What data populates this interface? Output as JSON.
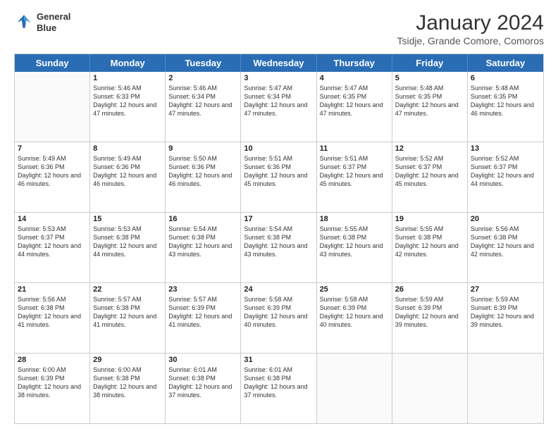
{
  "header": {
    "logo_line1": "General",
    "logo_line2": "Blue",
    "main_title": "January 2024",
    "sub_title": "Tsidje, Grande Comore, Comoros"
  },
  "days_of_week": [
    "Sunday",
    "Monday",
    "Tuesday",
    "Wednesday",
    "Thursday",
    "Friday",
    "Saturday"
  ],
  "weeks": [
    [
      {
        "day": "",
        "sunrise": "",
        "sunset": "",
        "daylight": ""
      },
      {
        "day": "1",
        "sunrise": "Sunrise: 5:46 AM",
        "sunset": "Sunset: 6:33 PM",
        "daylight": "Daylight: 12 hours and 47 minutes."
      },
      {
        "day": "2",
        "sunrise": "Sunrise: 5:46 AM",
        "sunset": "Sunset: 6:34 PM",
        "daylight": "Daylight: 12 hours and 47 minutes."
      },
      {
        "day": "3",
        "sunrise": "Sunrise: 5:47 AM",
        "sunset": "Sunset: 6:34 PM",
        "daylight": "Daylight: 12 hours and 47 minutes."
      },
      {
        "day": "4",
        "sunrise": "Sunrise: 5:47 AM",
        "sunset": "Sunset: 6:35 PM",
        "daylight": "Daylight: 12 hours and 47 minutes."
      },
      {
        "day": "5",
        "sunrise": "Sunrise: 5:48 AM",
        "sunset": "Sunset: 6:35 PM",
        "daylight": "Daylight: 12 hours and 47 minutes."
      },
      {
        "day": "6",
        "sunrise": "Sunrise: 5:48 AM",
        "sunset": "Sunset: 6:35 PM",
        "daylight": "Daylight: 12 hours and 46 minutes."
      }
    ],
    [
      {
        "day": "7",
        "sunrise": "Sunrise: 5:49 AM",
        "sunset": "Sunset: 6:36 PM",
        "daylight": "Daylight: 12 hours and 46 minutes."
      },
      {
        "day": "8",
        "sunrise": "Sunrise: 5:49 AM",
        "sunset": "Sunset: 6:36 PM",
        "daylight": "Daylight: 12 hours and 46 minutes."
      },
      {
        "day": "9",
        "sunrise": "Sunrise: 5:50 AM",
        "sunset": "Sunset: 6:36 PM",
        "daylight": "Daylight: 12 hours and 46 minutes."
      },
      {
        "day": "10",
        "sunrise": "Sunrise: 5:51 AM",
        "sunset": "Sunset: 6:36 PM",
        "daylight": "Daylight: 12 hours and 45 minutes."
      },
      {
        "day": "11",
        "sunrise": "Sunrise: 5:51 AM",
        "sunset": "Sunset: 6:37 PM",
        "daylight": "Daylight: 12 hours and 45 minutes."
      },
      {
        "day": "12",
        "sunrise": "Sunrise: 5:52 AM",
        "sunset": "Sunset: 6:37 PM",
        "daylight": "Daylight: 12 hours and 45 minutes."
      },
      {
        "day": "13",
        "sunrise": "Sunrise: 5:52 AM",
        "sunset": "Sunset: 6:37 PM",
        "daylight": "Daylight: 12 hours and 44 minutes."
      }
    ],
    [
      {
        "day": "14",
        "sunrise": "Sunrise: 5:53 AM",
        "sunset": "Sunset: 6:37 PM",
        "daylight": "Daylight: 12 hours and 44 minutes."
      },
      {
        "day": "15",
        "sunrise": "Sunrise: 5:53 AM",
        "sunset": "Sunset: 6:38 PM",
        "daylight": "Daylight: 12 hours and 44 minutes."
      },
      {
        "day": "16",
        "sunrise": "Sunrise: 5:54 AM",
        "sunset": "Sunset: 6:38 PM",
        "daylight": "Daylight: 12 hours and 43 minutes."
      },
      {
        "day": "17",
        "sunrise": "Sunrise: 5:54 AM",
        "sunset": "Sunset: 6:38 PM",
        "daylight": "Daylight: 12 hours and 43 minutes."
      },
      {
        "day": "18",
        "sunrise": "Sunrise: 5:55 AM",
        "sunset": "Sunset: 6:38 PM",
        "daylight": "Daylight: 12 hours and 43 minutes."
      },
      {
        "day": "19",
        "sunrise": "Sunrise: 5:55 AM",
        "sunset": "Sunset: 6:38 PM",
        "daylight": "Daylight: 12 hours and 42 minutes."
      },
      {
        "day": "20",
        "sunrise": "Sunrise: 5:56 AM",
        "sunset": "Sunset: 6:38 PM",
        "daylight": "Daylight: 12 hours and 42 minutes."
      }
    ],
    [
      {
        "day": "21",
        "sunrise": "Sunrise: 5:56 AM",
        "sunset": "Sunset: 6:38 PM",
        "daylight": "Daylight: 12 hours and 41 minutes."
      },
      {
        "day": "22",
        "sunrise": "Sunrise: 5:57 AM",
        "sunset": "Sunset: 6:38 PM",
        "daylight": "Daylight: 12 hours and 41 minutes."
      },
      {
        "day": "23",
        "sunrise": "Sunrise: 5:57 AM",
        "sunset": "Sunset: 6:39 PM",
        "daylight": "Daylight: 12 hours and 41 minutes."
      },
      {
        "day": "24",
        "sunrise": "Sunrise: 5:58 AM",
        "sunset": "Sunset: 6:39 PM",
        "daylight": "Daylight: 12 hours and 40 minutes."
      },
      {
        "day": "25",
        "sunrise": "Sunrise: 5:58 AM",
        "sunset": "Sunset: 6:39 PM",
        "daylight": "Daylight: 12 hours and 40 minutes."
      },
      {
        "day": "26",
        "sunrise": "Sunrise: 5:59 AM",
        "sunset": "Sunset: 6:39 PM",
        "daylight": "Daylight: 12 hours and 39 minutes."
      },
      {
        "day": "27",
        "sunrise": "Sunrise: 5:59 AM",
        "sunset": "Sunset: 6:39 PM",
        "daylight": "Daylight: 12 hours and 39 minutes."
      }
    ],
    [
      {
        "day": "28",
        "sunrise": "Sunrise: 6:00 AM",
        "sunset": "Sunset: 6:39 PM",
        "daylight": "Daylight: 12 hours and 38 minutes."
      },
      {
        "day": "29",
        "sunrise": "Sunrise: 6:00 AM",
        "sunset": "Sunset: 6:38 PM",
        "daylight": "Daylight: 12 hours and 38 minutes."
      },
      {
        "day": "30",
        "sunrise": "Sunrise: 6:01 AM",
        "sunset": "Sunset: 6:38 PM",
        "daylight": "Daylight: 12 hours and 37 minutes."
      },
      {
        "day": "31",
        "sunrise": "Sunrise: 6:01 AM",
        "sunset": "Sunset: 6:38 PM",
        "daylight": "Daylight: 12 hours and 37 minutes."
      },
      {
        "day": "",
        "sunrise": "",
        "sunset": "",
        "daylight": ""
      },
      {
        "day": "",
        "sunrise": "",
        "sunset": "",
        "daylight": ""
      },
      {
        "day": "",
        "sunrise": "",
        "sunset": "",
        "daylight": ""
      }
    ]
  ]
}
